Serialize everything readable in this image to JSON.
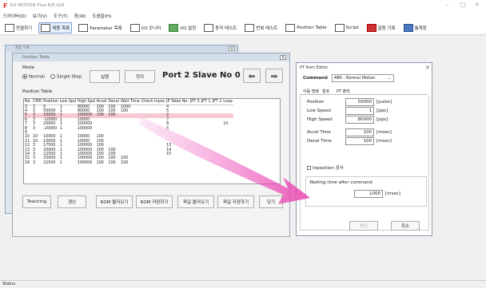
{
  "app": {
    "title": "Ezi MOTION Plus-R/E GUI"
  },
  "menu": [
    "드라이버(D)",
    "보기(V)",
    "도구(T)",
    "창(W)",
    "도움말(H)"
  ],
  "toolbar": [
    {
      "label": "연결하기",
      "icon": "connect-icon"
    },
    {
      "label": "제품 목록",
      "icon": "product-list-icon"
    },
    {
      "label": "Parameter 목록",
      "icon": "parameter-icon"
    },
    {
      "label": "I/O 모니터",
      "icon": "io-monitor-icon"
    },
    {
      "label": "I/O 설정",
      "icon": "io-settings-icon"
    },
    {
      "label": "동작 테스트",
      "icon": "motion-test-icon"
    },
    {
      "label": "반복 테스트",
      "icon": "repeat-test-icon"
    },
    {
      "label": "Position Table",
      "icon": "position-table-icon"
    },
    {
      "label": "Script",
      "icon": "script-icon"
    },
    {
      "label": "알람 기록",
      "icon": "alarm-log-icon"
    },
    {
      "label": "통계창",
      "icon": "stats-icon"
    }
  ],
  "product_window": {
    "title": "제품 목록"
  },
  "pt": {
    "title": "Position Table",
    "mode_label": "Mode",
    "mode_normal": "Normal",
    "mode_single": "Single Step",
    "run_btn": "실행",
    "stop_btn": "정지",
    "port_slave": "Port 2 Slave No 0",
    "table_label": "Position Table",
    "columns": [
      "No.",
      "CMD",
      "Position",
      "Low Spd",
      "High Spd",
      "Accel",
      "Decel",
      "Wait Time",
      "Check Inpos",
      "JP Table No.",
      "JPT 0",
      "JPT 1",
      "JPT 2",
      "Loop"
    ],
    "rows": [
      [
        "3",
        "3",
        "0",
        "1",
        "80000",
        "100",
        "100",
        "1000",
        "",
        "4",
        "",
        "",
        "",
        ""
      ],
      [
        "4",
        "3",
        "50000",
        "1",
        "80000",
        "100",
        "100",
        "100",
        "",
        "5",
        "",
        "",
        "",
        ""
      ],
      [
        "5",
        "3",
        "10000",
        "1",
        "100000",
        "100",
        "100",
        "",
        "",
        "2",
        "",
        "",
        "",
        ""
      ],
      [
        "6",
        "3",
        "-10000",
        "1",
        "10000",
        "",
        "",
        "",
        "",
        "7",
        "",
        "",
        "",
        ""
      ],
      [
        "7",
        "3",
        "20000",
        "1",
        "100000",
        "",
        "",
        "",
        "",
        "8",
        "",
        "",
        "",
        "10"
      ],
      [
        "8",
        "3",
        "-20000",
        "1",
        "100000",
        "",
        "",
        "",
        "",
        "5",
        "",
        "",
        "",
        ""
      ],
      [
        "9",
        "",
        "",
        "",
        "",
        "",
        "",
        "",
        "",
        "",
        "",
        "",
        "",
        ""
      ],
      [
        "10",
        "10",
        "10000",
        "1",
        "10000",
        "100",
        "",
        "",
        "",
        "",
        "",
        "",
        "",
        ""
      ],
      [
        "11",
        "10",
        "10000",
        "1",
        "10000",
        "100",
        "",
        "",
        "",
        "",
        "",
        "",
        "",
        ""
      ],
      [
        "12",
        "3",
        "17500",
        "1",
        "100000",
        "100",
        "",
        "",
        "",
        "13",
        "",
        "",
        "",
        ""
      ],
      [
        "13",
        "3",
        "20000",
        "1",
        "100000",
        "100",
        "100",
        "",
        "",
        "14",
        "",
        "",
        "",
        ""
      ],
      [
        "14",
        "3",
        "22500",
        "1",
        "100000",
        "100",
        "100",
        "",
        "",
        "15",
        "",
        "",
        "",
        ""
      ],
      [
        "15",
        "3",
        "25000",
        "1",
        "100000",
        "100",
        "100",
        "100",
        "",
        "",
        "",
        "",
        "",
        ""
      ],
      [
        "16",
        "3",
        "22500",
        "1",
        "100000",
        "100",
        "100",
        "100",
        "",
        "",
        "",
        "",
        "",
        ""
      ]
    ],
    "selected_row": 2,
    "buttons": [
      "Teaching",
      "갱신",
      "ROM 불러오기",
      "ROM 저장하기",
      "파일 불러오기",
      "파일 저장하기",
      "닫기"
    ]
  },
  "editor": {
    "title": "PT Item Editor",
    "command_label": "Command",
    "command_value": "ABS - Normal Motion",
    "tabs": [
      "이동 명령",
      "점프",
      "PT 출력"
    ],
    "fields": [
      {
        "label": "Position",
        "value": "50000",
        "unit": "[pulse]"
      },
      {
        "label": "Low Speed",
        "value": "1",
        "unit": "[pps]"
      },
      {
        "label": "High Speed",
        "value": "80000",
        "unit": "[pps]"
      },
      {
        "label": "Accel Time",
        "value": "100",
        "unit": "[msec]"
      },
      {
        "label": "Decel Time",
        "value": "100",
        "unit": "[msec]"
      }
    ],
    "inposition_label": "Inposition 검사",
    "wait_label": "Waiting time after command",
    "wait_value": "1000",
    "wait_unit": "[msec]",
    "ok_btn": "확인",
    "cancel_btn": "취소"
  },
  "status": "Status"
}
